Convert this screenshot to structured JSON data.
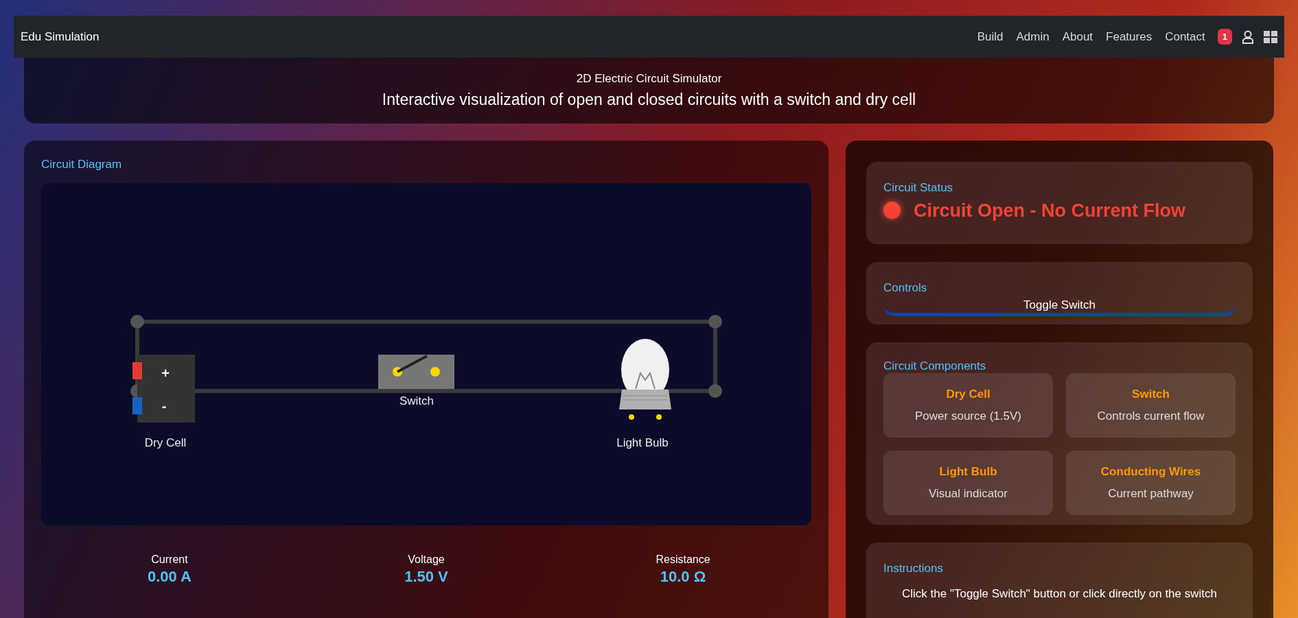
{
  "navbar": {
    "brand": "Edu Simulation",
    "links": [
      "Build",
      "Admin",
      "About",
      "Features",
      "Contact"
    ],
    "notification_count": "1"
  },
  "header": {
    "title": "2D Electric Circuit Simulator",
    "subtitle": "Interactive visualization of open and closed circuits with a switch and dry cell"
  },
  "diagram_panel": {
    "title": "Circuit Diagram",
    "circuit": {
      "closed": false,
      "positive_sign": "+",
      "negative_sign": "-",
      "cell_label": "Dry Cell",
      "switch_label": "Switch",
      "bulb_label": "Light Bulb"
    }
  },
  "readings": [
    {
      "label": "Current",
      "value": "0.00 A"
    },
    {
      "label": "Voltage",
      "value": "1.50 V"
    },
    {
      "label": "Resistance",
      "value": "10.0 Ω"
    }
  ],
  "status": {
    "title": "Circuit Status",
    "text": "Circuit Open - No Current Flow",
    "closed": false
  },
  "controls": {
    "title": "Controls",
    "button": "Toggle Switch"
  },
  "components": {
    "title": "Circuit Components",
    "items": [
      {
        "name": "Dry Cell",
        "description": "Power source (1.5V)"
      },
      {
        "name": "Switch",
        "description": "Controls current flow"
      },
      {
        "name": "Light Bulb",
        "description": "Visual indicator"
      },
      {
        "name": "Conducting Wires",
        "description": "Current pathway"
      }
    ]
  },
  "instructions": {
    "title": "Instructions",
    "text": "Click the \"Toggle Switch\" button or click directly on the switch"
  }
}
